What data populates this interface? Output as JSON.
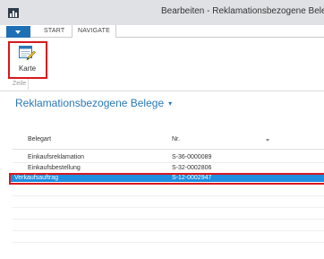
{
  "window": {
    "title": "Bearbeiten - Reklamationsbezogene Belege"
  },
  "ribbon": {
    "tabs": [
      {
        "label": "START",
        "active": false
      },
      {
        "label": "NAVIGATE",
        "active": true
      }
    ],
    "buttons": [
      {
        "label": "Karte",
        "icon": "card-edit-icon",
        "highlighted": true
      }
    ],
    "group_label": "Zeile"
  },
  "page": {
    "title": "Reklamationsbezogene Belege",
    "title_caret": "▾"
  },
  "table": {
    "columns": [
      "Belegart",
      "Nr."
    ],
    "rows": [
      {
        "belegart": "Einkaufsreklamation",
        "nr": "S-36-0000089",
        "selected": false
      },
      {
        "belegart": "Einkaufsbestellung",
        "nr": "S-32-0002806",
        "selected": false
      },
      {
        "belegart": "Verkaufsauftrag",
        "nr": "S-12-0002947",
        "selected": true
      }
    ]
  },
  "colors": {
    "accent": "#2a79b8",
    "selection": "#1f8de0",
    "highlight_border": "#d8181c",
    "file_tab": "#1f6fb5"
  }
}
